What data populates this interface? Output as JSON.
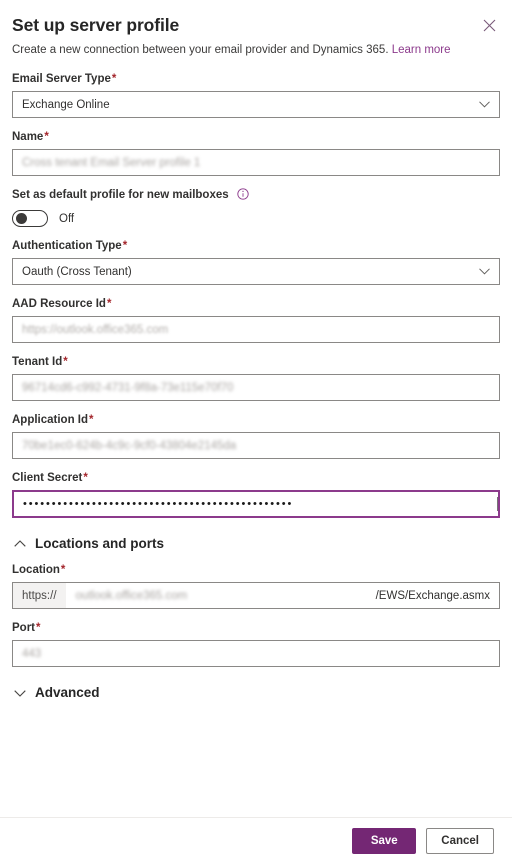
{
  "header": {
    "title": "Set up server profile",
    "subtitle": "Create a new connection between your email provider and Dynamics 365.",
    "learn_more": "Learn more",
    "close_icon": "close-icon"
  },
  "fields": {
    "email_server_type": {
      "label": "Email Server Type",
      "required": "*",
      "value": "Exchange Online"
    },
    "name": {
      "label": "Name",
      "required": "*",
      "value": "Cross tenant Email Server profile 1"
    },
    "default_profile": {
      "label": "Set as default profile for new mailboxes",
      "info_icon": "info-icon",
      "toggle_state": "Off"
    },
    "authentication_type": {
      "label": "Authentication Type",
      "required": "*",
      "value": "Oauth (Cross Tenant)"
    },
    "aad_resource_id": {
      "label": "AAD Resource Id",
      "required": "*",
      "value": "https://outlook.office365.com"
    },
    "tenant_id": {
      "label": "Tenant Id",
      "required": "*",
      "value": "96714cd6-c992-4731-9f8a-73e115e70f70"
    },
    "application_id": {
      "label": "Application Id",
      "required": "*",
      "value": "70be1ec0-624b-4c9c-9cf0-43804e2145da"
    },
    "client_secret": {
      "label": "Client Secret",
      "required": "*",
      "value": "•••••••••••••••••••••••••••••••••••••••••••••••"
    },
    "location": {
      "label": "Location",
      "required": "*",
      "prefix": "https://",
      "value": "outlook.office365.com",
      "suffix": "/EWS/Exchange.asmx"
    },
    "port": {
      "label": "Port",
      "required": "*",
      "value": "443"
    }
  },
  "sections": {
    "locations_and_ports": {
      "title": "Locations and ports",
      "chevron": "chevron-up-icon",
      "expanded": "true"
    },
    "advanced": {
      "title": "Advanced",
      "chevron": "chevron-down-icon",
      "expanded": "false"
    }
  },
  "footer": {
    "save_label": "Save",
    "cancel_label": "Cancel"
  },
  "colors": {
    "accent": "#742774",
    "link": "#8c3a8c",
    "required": "#a4262c",
    "border": "#8a8886"
  }
}
